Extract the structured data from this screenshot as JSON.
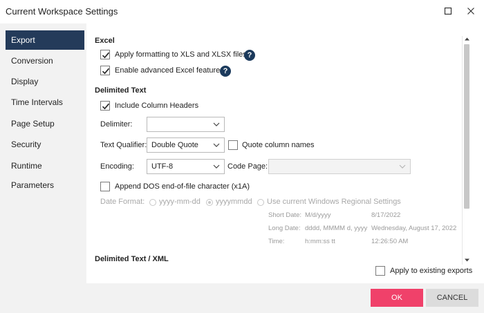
{
  "window": {
    "title": "Current Workspace Settings"
  },
  "sidebar": {
    "items": [
      {
        "label": "Export"
      },
      {
        "label": "Conversion"
      },
      {
        "label": "Display"
      },
      {
        "label": "Time Intervals"
      },
      {
        "label": "Page Setup"
      },
      {
        "label": "Security"
      },
      {
        "label": "Runtime Parameters"
      }
    ],
    "active": "Export"
  },
  "excel": {
    "heading": "Excel",
    "apply_formatting_label": "Apply formatting to XLS and XLSX files",
    "apply_formatting_checked": true,
    "advanced_label": "Enable advanced Excel features",
    "advanced_checked": true,
    "help_glyph": "?"
  },
  "delimited": {
    "heading": "Delimited Text",
    "include_headers_label": "Include Column Headers",
    "include_headers_checked": true,
    "delimiter_label": "Delimiter:",
    "delimiter_value": "",
    "qualifier_label": "Text Qualifier:",
    "qualifier_value": "Double Quote",
    "quote_names_label": "Quote column names",
    "quote_names_checked": false,
    "encoding_label": "Encoding:",
    "encoding_value": "UTF-8",
    "codepage_label": "Code Page:",
    "codepage_value": "",
    "append_dos_label": "Append DOS end-of-file character (x1A)",
    "append_dos_checked": false,
    "date_format_label": "Date Format:",
    "date_options": [
      "yyyy-mm-dd",
      "yyyymmdd",
      "Use current Windows Regional Settings"
    ],
    "date_selected": "yyyymmdd",
    "short_date_label": "Short Date:",
    "short_date_format": "M/d/yyyy",
    "short_date_example": "8/17/2022",
    "long_date_label": "Long Date:",
    "long_date_format": "dddd, MMMM d, yyyy",
    "long_date_example": "Wednesday, August 17, 2022",
    "time_label": "Time:",
    "time_format": "h:mm:ss tt",
    "time_example": "12:26:50 AM"
  },
  "delimited_xml": {
    "heading": "Delimited Text / XML"
  },
  "apply_existing": {
    "label": "Apply to existing exports",
    "checked": false
  },
  "buttons": {
    "ok": "OK",
    "cancel": "CANCEL"
  },
  "colors": {
    "sidebar_active": "#243b5a",
    "ok_button": "#f0416a",
    "cancel_button": "#dcdcdc",
    "help_icon": "#1b3a5c"
  }
}
